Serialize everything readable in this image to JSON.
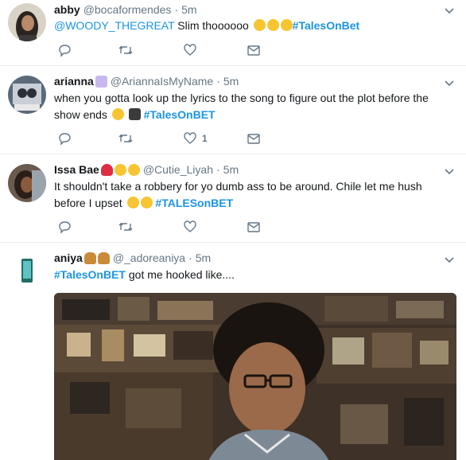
{
  "tweets": [
    {
      "name": "abby",
      "handle": "@bocaformendes",
      "sep": "·",
      "time": "5m",
      "mention": "@WOODY_THEGREAT",
      "text": " Slim thoooooo ",
      "hashtag": "#TalesOnBet",
      "emojis": [
        "heart-eyes-icon",
        "heart-eyes-icon",
        "heart-eyes-icon"
      ]
    },
    {
      "name": "arianna",
      "handle": "@AriannaIsMyName",
      "sep": "·",
      "time": "5m",
      "text": "when you gotta look up the lyrics to the song to figure out the plot before the show ends",
      "hashtag": "#TalesOnBET",
      "like_count": "1",
      "emojis": [
        "sparkles-icon",
        "unamused-face-icon",
        "spy-icon"
      ]
    },
    {
      "name": "Issa Bae",
      "handle": "@Cutie_Liyah",
      "sep": "·",
      "time": "5m",
      "text": "It shouldn't take a robbery for yo dumb ass to be around. Chile let me hush before I upset",
      "hashtag": "#TALESonBET",
      "emojis": [
        "red-heart-icon",
        "grimace-face-icon",
        "heart-eyes-icon",
        "joy-face-icon",
        "joy-face-icon"
      ]
    },
    {
      "name": "aniya",
      "handle": "@_adoreaniya",
      "sep": "·",
      "time": "5m",
      "hashtag": "#TalesOnBET",
      "text": " got me hooked like....",
      "emojis": [
        "hamburger-icon",
        "hamburger-icon"
      ]
    }
  ],
  "colors": {
    "link": "#1b95e0",
    "muted": "#657786",
    "border": "#e6ecf0"
  }
}
